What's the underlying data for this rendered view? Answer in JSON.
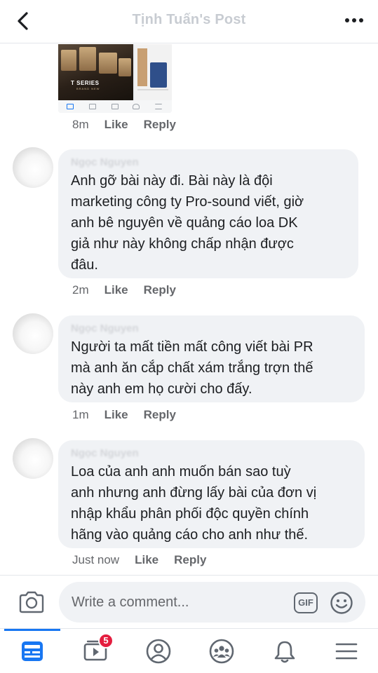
{
  "header": {
    "title": "Tịnh Tuấn's Post",
    "back_icon": "chevron-left-icon",
    "more_icon": "more-horizontal-icon"
  },
  "attached_comment": {
    "image_text": "T SERIES",
    "image_subtext": "BRAND NEW",
    "time": "8m",
    "like_label": "Like",
    "reply_label": "Reply"
  },
  "comments": [
    {
      "author": "Ngọc Nguyen",
      "text": "Anh gỡ bài này đi. Bài này là đội\nmarketing công ty Pro-sound viết, giờ\nanh bê nguyên về quảng cáo loa DK\ngiả như này không chấp nhận được\nđâu.",
      "time": "2m",
      "like_label": "Like",
      "reply_label": "Reply"
    },
    {
      "author": "Ngọc Nguyen",
      "text": "Người ta mất tiền mất công viết bài PR\nmà anh ăn cắp chất xám trắng trợn thế\nnày anh em họ cười cho đấy.",
      "time": "1m",
      "like_label": "Like",
      "reply_label": "Reply"
    },
    {
      "author": "Ngọc Nguyen",
      "text": "Loa của anh anh muốn bán sao tuỳ\nanh nhưng anh đừng lấy bài của đơn vị\nnhập khẩu phân phối độc quyền chính\nhãng vào quảng cáo cho anh như thế.",
      "time": "Just now",
      "like_label": "Like",
      "reply_label": "Reply"
    }
  ],
  "composer": {
    "placeholder": "Write a comment...",
    "camera_icon": "camera-icon",
    "gif_label": "GIF",
    "emoji_icon": "smiley-icon"
  },
  "tabbar": {
    "tabs": [
      {
        "name": "news-feed",
        "icon": "news-feed-icon",
        "active": true
      },
      {
        "name": "watch",
        "icon": "video-icon",
        "badge": "5"
      },
      {
        "name": "profile",
        "icon": "profile-icon"
      },
      {
        "name": "groups",
        "icon": "groups-icon"
      },
      {
        "name": "notifications",
        "icon": "bell-icon"
      },
      {
        "name": "menu",
        "icon": "menu-icon"
      }
    ]
  },
  "colors": {
    "accent": "#1877f2",
    "bubble": "#f0f2f5",
    "secondary_text": "#65676b",
    "badge": "#e41e3f"
  }
}
